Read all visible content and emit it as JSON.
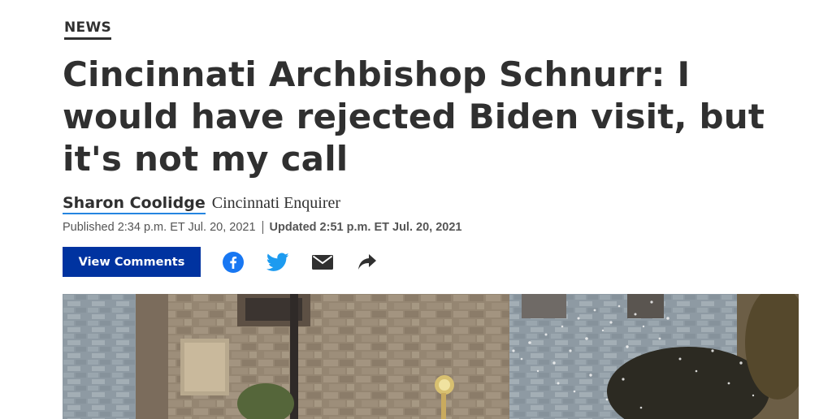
{
  "article": {
    "section": "NEWS",
    "headline": "Cincinnati Archbishop Schnurr: I would have rejected Biden visit, but it's not my call",
    "author": "Sharon Coolidge",
    "publication": "Cincinnati Enquirer",
    "published": "Published 2:34 p.m. ET Jul. 20, 2021",
    "updated": "Updated 2:51 p.m. ET Jul. 20, 2021"
  },
  "toolbar": {
    "comments_label": "View Comments",
    "share_icons": [
      "facebook-icon",
      "twitter-icon",
      "email-icon",
      "share-arrow-icon"
    ]
  },
  "colors": {
    "accent_blue": "#0033a0",
    "author_underline": "#2585e0",
    "facebook": "#1877f2",
    "twitter": "#1d9bf0",
    "text": "#303030"
  }
}
